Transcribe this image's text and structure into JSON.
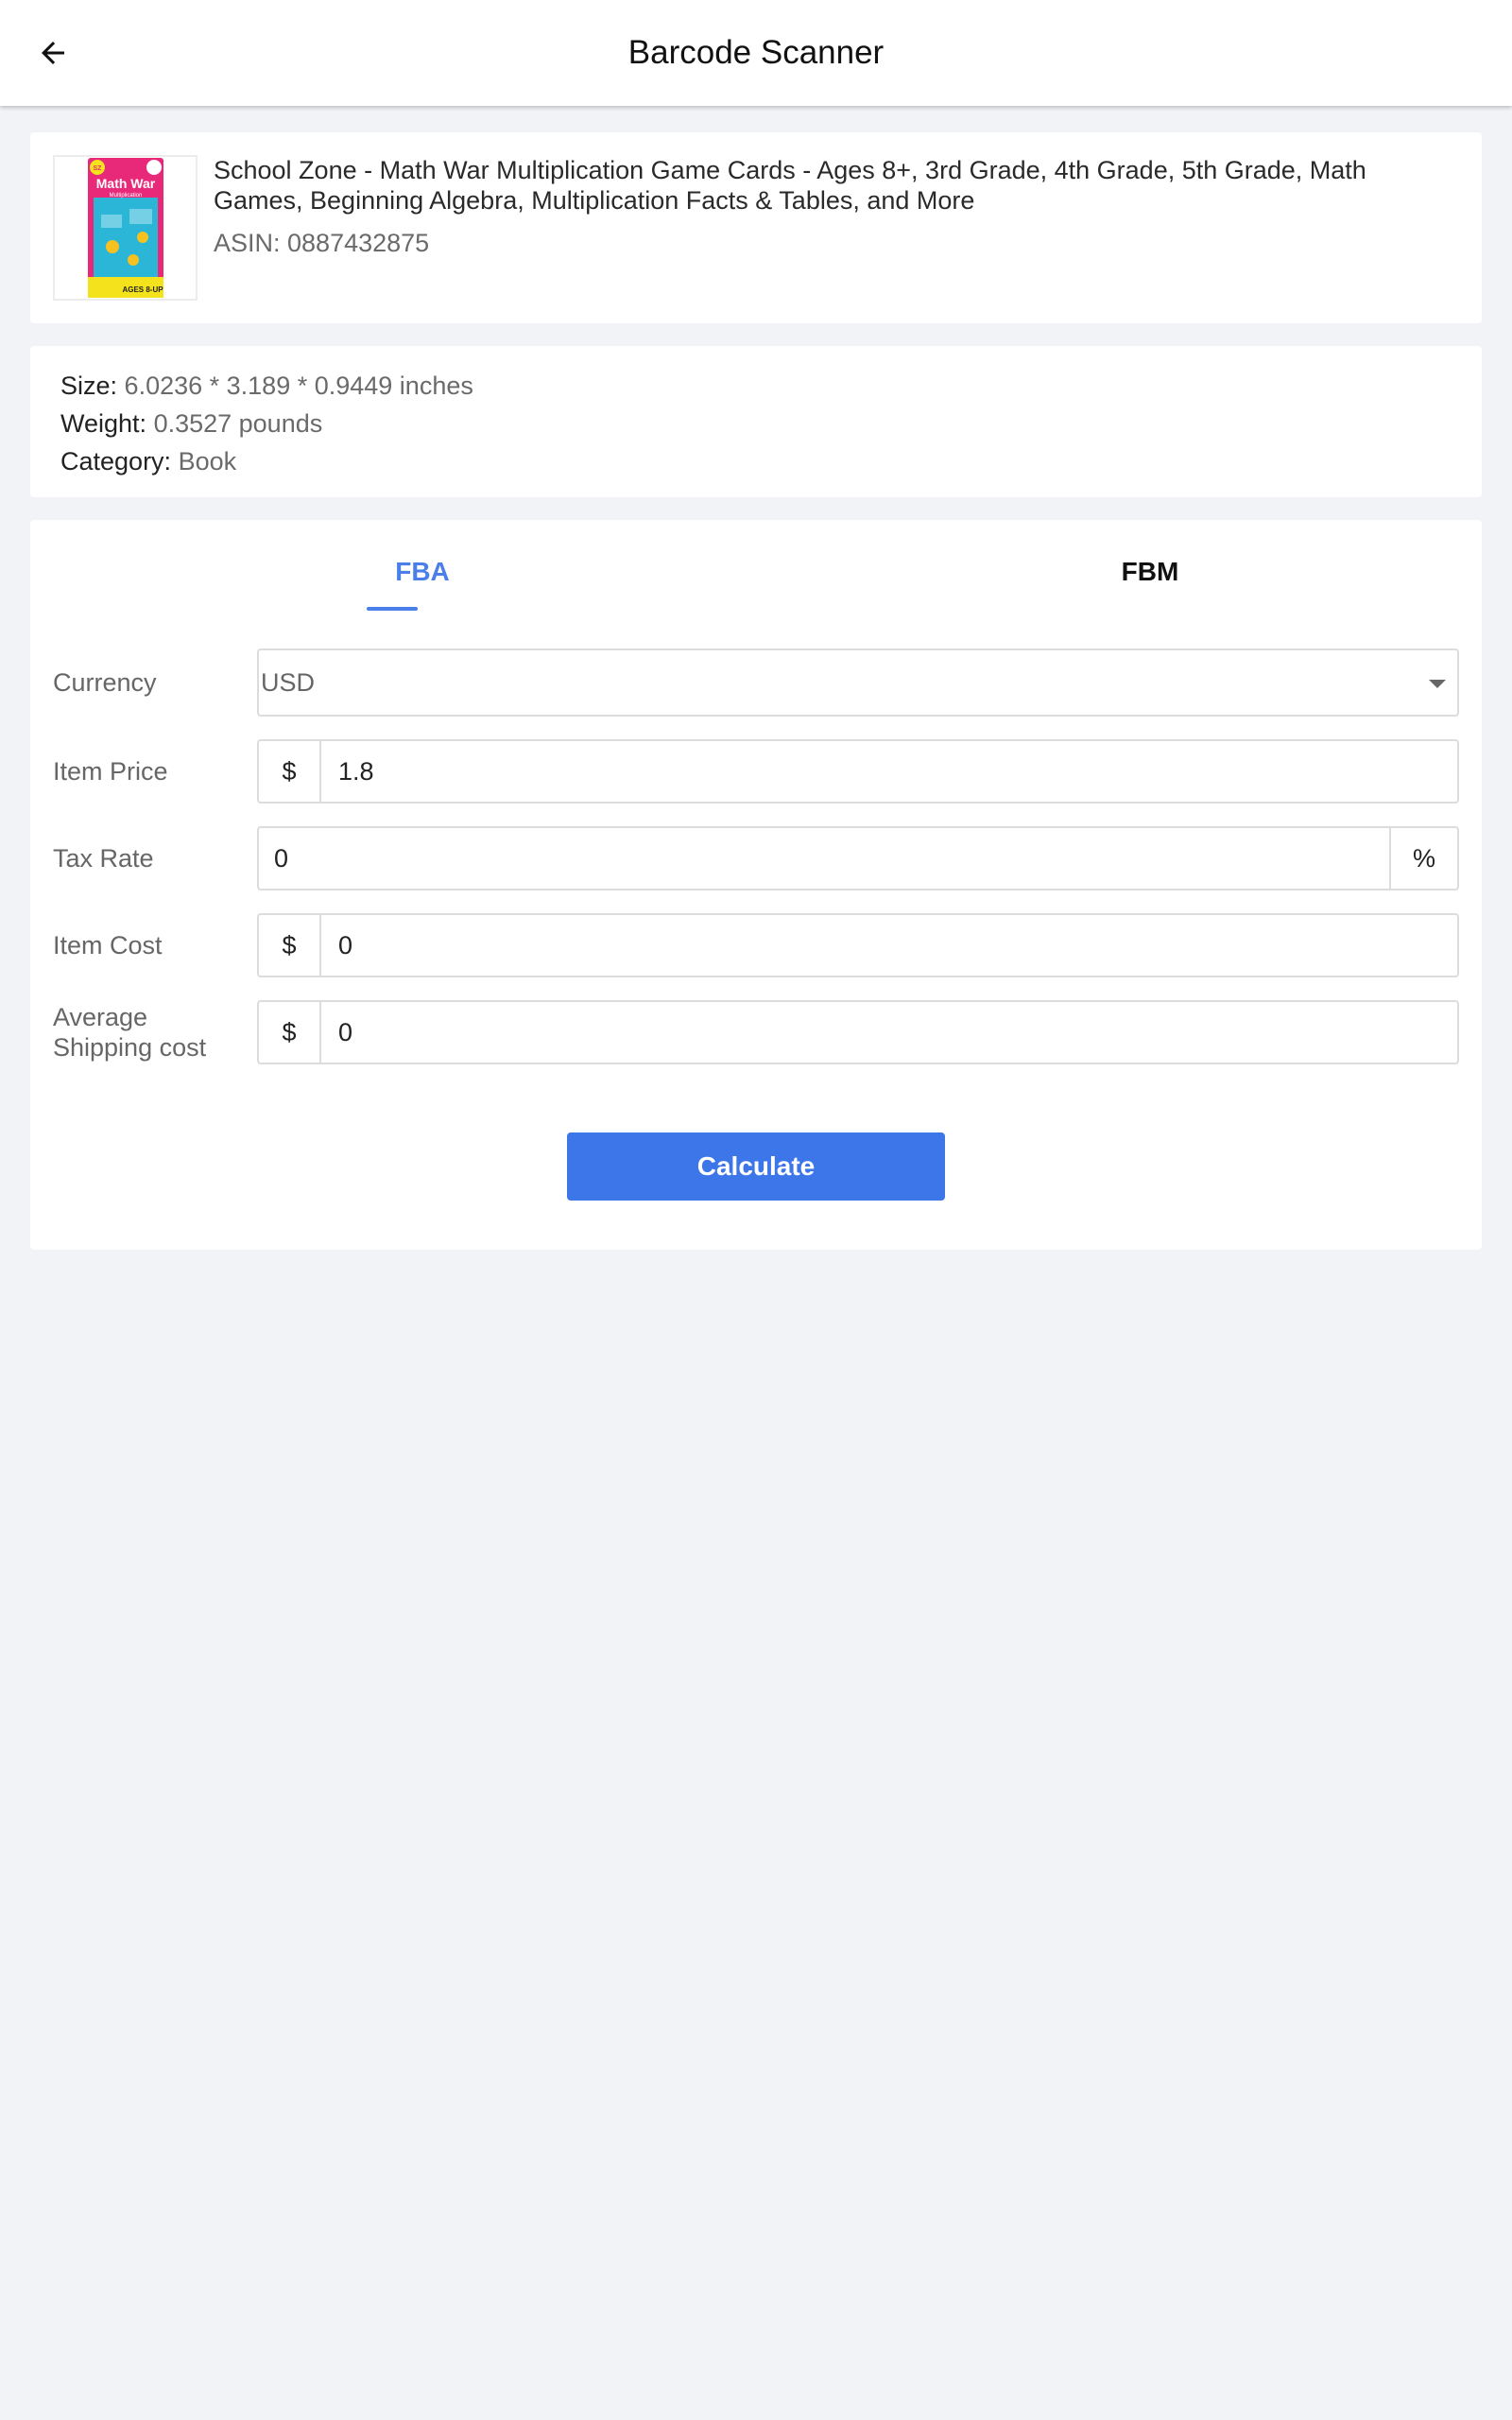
{
  "app_bar": {
    "title": "Barcode Scanner"
  },
  "product": {
    "title": "School Zone - Math War Multiplication Game Cards - Ages 8+, 3rd Grade, 4th Grade, 5th Grade, Math Games, Beginning Algebra, Multiplication Facts & Tables, and More",
    "asin": "ASIN: 0887432875",
    "thumbnail_text": {
      "brand": "SZ",
      "name": "Math War",
      "sub": "Multiplication",
      "age": "AGES 8-UP"
    }
  },
  "details": {
    "size_label": "Size:",
    "size_value": "6.0236 * 3.189 * 0.9449 inches",
    "weight_label": "Weight:",
    "weight_value": "0.3527 pounds",
    "category_label": "Category:",
    "category_value": "Book"
  },
  "tabs": {
    "fba": "FBA",
    "fbm": "FBM",
    "active": "FBA"
  },
  "form": {
    "currency_label": "Currency",
    "currency_value": "USD",
    "item_price_label": "Item Price",
    "item_price_prefix": "$",
    "item_price_value": "1.8",
    "tax_rate_label": "Tax Rate",
    "tax_rate_value": "0",
    "tax_rate_suffix": "%",
    "item_cost_label": "Item Cost",
    "item_cost_prefix": "$",
    "item_cost_value": "0",
    "shipping_label_line1": "Average",
    "shipping_label_line2": "Shipping cost",
    "shipping_prefix": "$",
    "shipping_value": "0",
    "calculate_label": "Calculate"
  },
  "colors": {
    "accent": "#4a7ee8",
    "button": "#3c76e9",
    "background": "#f1f3f7"
  }
}
